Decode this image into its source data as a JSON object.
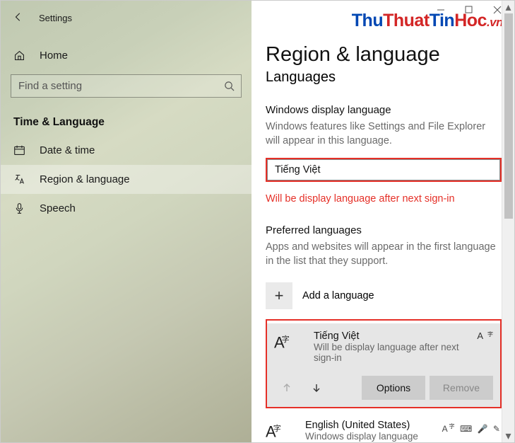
{
  "header": {
    "title": "Settings"
  },
  "sidebar": {
    "home": "Home",
    "search_placeholder": "Find a setting",
    "group": "Time & Language",
    "items": [
      {
        "label": "Date & time"
      },
      {
        "label": "Region & language"
      },
      {
        "label": "Speech"
      }
    ]
  },
  "main": {
    "title": "Region & language",
    "subtitle": "Languages",
    "display_lang": {
      "heading": "Windows display language",
      "helper": "Windows features like Settings and File Explorer will appear in this language.",
      "selected": "Tiếng Việt",
      "status": "Will be display language after next sign-in"
    },
    "preferred": {
      "heading": "Preferred languages",
      "helper": "Apps and websites will appear in the first language in the list that they support.",
      "add_label": "Add a language",
      "options_label": "Options",
      "remove_label": "Remove",
      "languages": [
        {
          "name": "Tiếng Việt",
          "sub": "Will be display language after next sign-in"
        },
        {
          "name": "English (United States)",
          "sub": "Windows display language"
        }
      ]
    }
  }
}
